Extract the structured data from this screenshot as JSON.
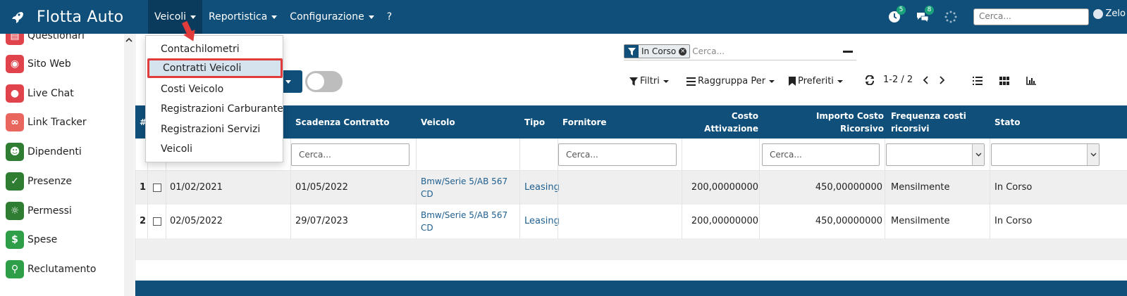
{
  "app": {
    "name": "Flotta Auto"
  },
  "topmenu": [
    {
      "label": "Veicoli",
      "caret": true,
      "active": true
    },
    {
      "label": "Reportistica",
      "caret": true
    },
    {
      "label": "Configurazione",
      "caret": true
    },
    {
      "label": "?",
      "caret": false
    }
  ],
  "topright": {
    "activity_count": "5",
    "messages_count": "8",
    "search_placeholder": "Cerca...",
    "user_name": "Zelo"
  },
  "sidebar": {
    "items": [
      {
        "label": "Questionari",
        "icon": "survey-icon",
        "color": "#e0434b"
      },
      {
        "label": "Sito Web",
        "icon": "globe-icon",
        "color": "#e0434b"
      },
      {
        "label": "Live Chat",
        "icon": "chat-icon",
        "color": "#e0434b"
      },
      {
        "label": "Link Tracker",
        "icon": "link-icon",
        "color": "#e9665f"
      },
      {
        "label": "Dipendenti",
        "icon": "people-icon",
        "color": "#2e7d32"
      },
      {
        "label": "Presenze",
        "icon": "user-check-icon",
        "color": "#2e7d32"
      },
      {
        "label": "Permessi",
        "icon": "sun-icon",
        "color": "#2e7d32"
      },
      {
        "label": "Spese",
        "icon": "dollar-icon",
        "color": "#2e9e48"
      },
      {
        "label": "Reclutamento",
        "icon": "search-person-icon",
        "color": "#2e9e48"
      }
    ]
  },
  "dropdown": {
    "items": [
      {
        "label": "Contachilometri"
      },
      {
        "label": "Contratti Veicoli",
        "highlighted": true
      },
      {
        "label": "Costi Veicolo"
      },
      {
        "label": "Registrazioni Carburante"
      },
      {
        "label": "Registrazioni Servizi"
      },
      {
        "label": "Veicoli"
      }
    ]
  },
  "search": {
    "facet_label": "In Corso",
    "placeholder": "Cerca..."
  },
  "controls": {
    "filters": "Filtri",
    "group_by": "Raggruppa Per",
    "favorites": "Preferiti",
    "pager": "1-2 / 2"
  },
  "table": {
    "headers": {
      "num": "#",
      "scadenza": "Scadenza Contratto",
      "veicolo": "Veicolo",
      "tipo": "Tipo",
      "fornitore": "Fornitore",
      "costo_attivazione": "Costo Attivazione",
      "importo": "Importo Costo Ricorsivo",
      "frequenza": "Frequenza costi ricorsivi",
      "stato": "Stato"
    },
    "filter_placeholders": {
      "scadenza": "Cerca...",
      "fornitore": "Cerca...",
      "importo": "Cerca..."
    },
    "rows": [
      {
        "num": "1",
        "inizio": "01/02/2021",
        "scadenza": "01/05/2022",
        "veicolo": "Bmw/Serie 5/AB 567 CD",
        "tipo": "Leasing",
        "fornitore": "",
        "costo_attivazione": "200,00000000",
        "importo": "450,00000000",
        "frequenza": "Mensilmente",
        "stato": "In Corso"
      },
      {
        "num": "2",
        "inizio": "02/05/2022",
        "scadenza": "29/07/2023",
        "veicolo": "Bmw/Serie 5/AB 567 CD",
        "tipo": "Leasing",
        "fornitore": "",
        "costo_attivazione": "200,00000000",
        "importo": "450,00000000",
        "frequenza": "Mensilmente",
        "stato": "In Corso"
      }
    ]
  },
  "colors": {
    "navbar": "#0f4f7a",
    "highlight_border": "#e23b3b",
    "link": "#1e5f8f"
  }
}
